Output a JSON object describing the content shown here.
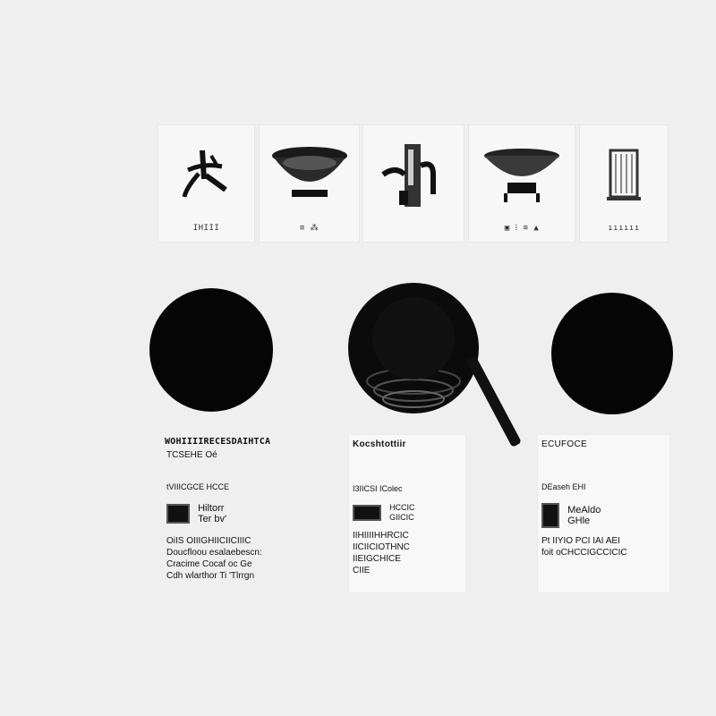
{
  "thumbnails": [
    {
      "icon": "ink-figure-icon",
      "caption": "IHIII"
    },
    {
      "icon": "bowl-icon",
      "caption": "≡                 ⁂"
    },
    {
      "icon": "faucet-icon",
      "caption": ""
    },
    {
      "icon": "dish-on-stand-icon",
      "caption": "▣    ⁞ ≋    ▲"
    },
    {
      "icon": "book-icon",
      "caption": "ıııııı"
    }
  ],
  "cards": [
    {
      "header": "WOHIIIIRECESDAIHTCA",
      "subheader": "TCSEHE  Oé",
      "section_label": "tVIIICGCE   HCCE",
      "feature_text_1": "Hiltorr",
      "feature_text_2": "Ter bv'",
      "body_lines": [
        "OiIS     OIIIGHIICIICIIIC",
        "Doucfloou esalaebescn:",
        "Cracime Cocaf   oc Ge",
        "Cdh wlarthor Ti 'Tlrrgn"
      ]
    },
    {
      "header": "Kocshtottiir",
      "subheader": "",
      "section_label": "I3IICSI IColec",
      "feature_text_1": "HCCIC",
      "feature_text_2": "GIICIC",
      "body_lines": [
        "IIHIIIIHHRCIC",
        "IICIICIOTHNC",
        "IIEIGCHICE",
        "CIIE"
      ]
    },
    {
      "header": "ECUFOCE",
      "subheader": "",
      "section_label": "DEaseh   EHI",
      "feature_text_1": "MeAldo",
      "feature_text_2": "GHle",
      "body_lines": [
        "Pt IIYIO PCI IAI AEI",
        "foit  oCHCCIGCCICIC",
        "",
        ""
      ]
    }
  ]
}
